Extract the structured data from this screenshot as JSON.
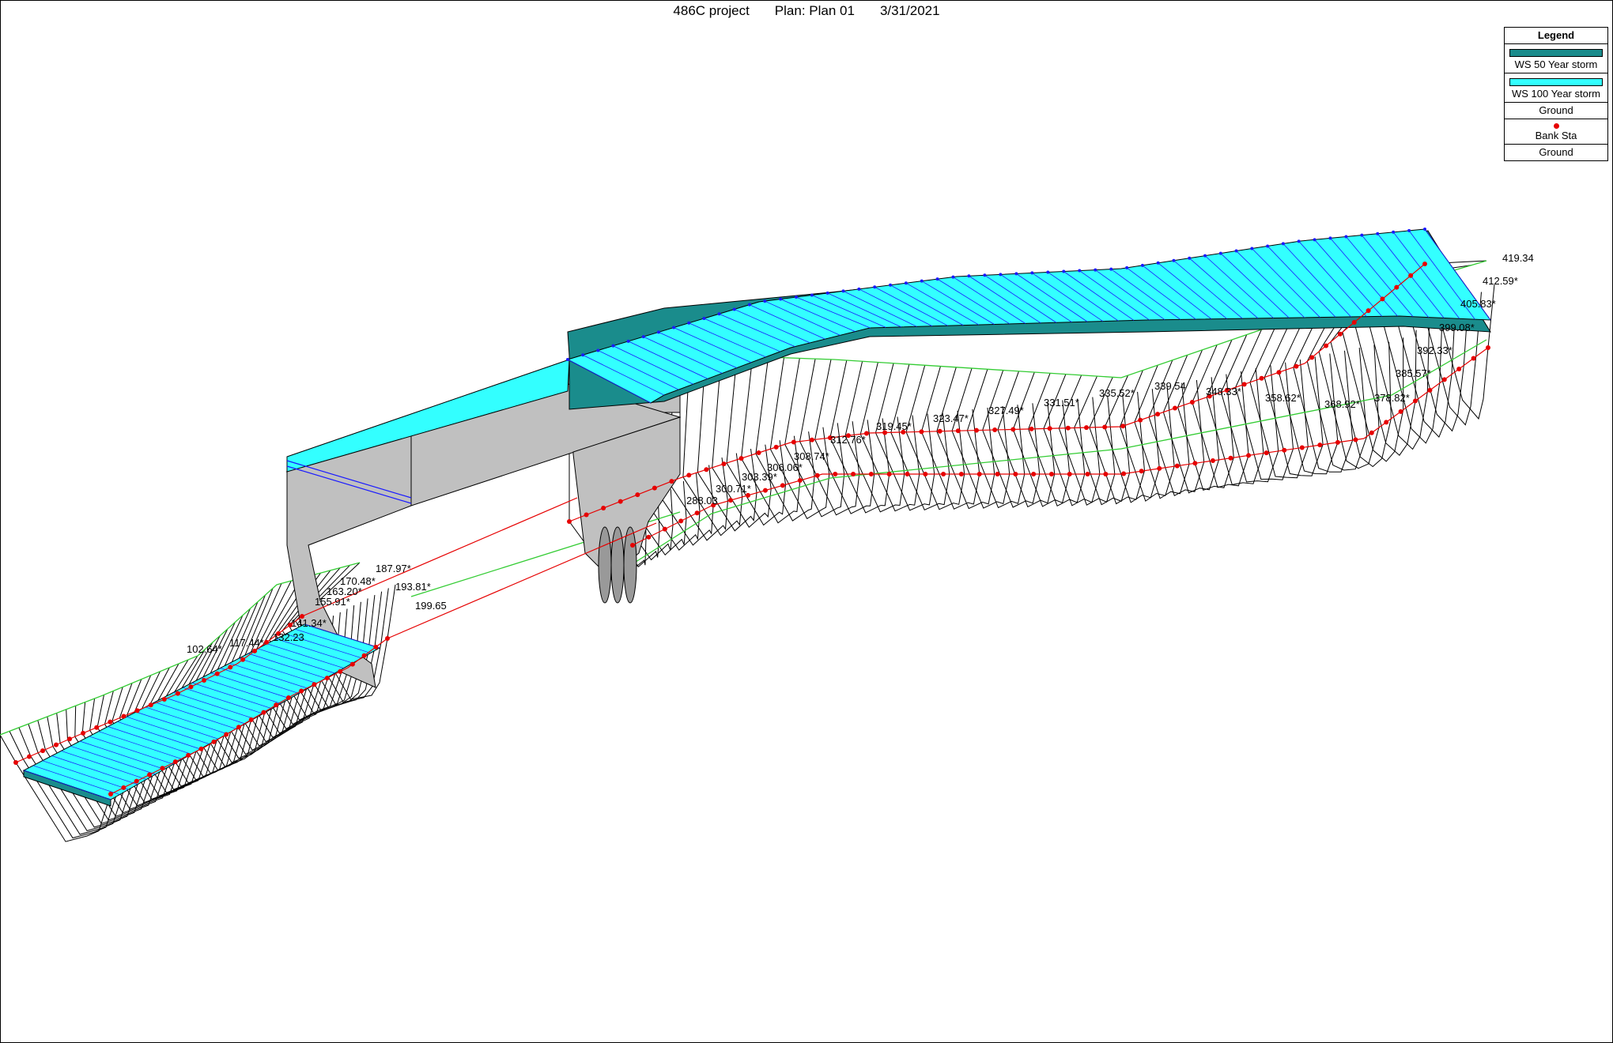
{
  "header": {
    "project": "486C project",
    "plan": "Plan: Plan 01",
    "date": "3/31/2021"
  },
  "legend": {
    "title": "Legend",
    "items": [
      {
        "label": "WS 50 Year storm",
        "color": "#1a8c8c"
      },
      {
        "label": "WS 100 Year storm",
        "color": "#33ffff"
      },
      {
        "label": "Ground",
        "color": "#33cc33"
      },
      {
        "label": "Bank Sta",
        "color": "#e60000"
      },
      {
        "label": "Ground",
        "color": "#000000"
      }
    ]
  },
  "colors": {
    "ws50": "#1a8c8c",
    "ws100": "#33ffff",
    "ground_outline": "#33cc33",
    "bank_sta": "#e60000",
    "ground": "#000000",
    "structure": "#c0c0c0",
    "ws_lines": "#1a1aff"
  },
  "cross_sections": [
    "102.64*",
    "117.44*",
    "132.23",
    "141.34*",
    "155.91*",
    "163.20*",
    "170.48*",
    "187.97*",
    "193.81*",
    "199.65",
    "288.03",
    "300.71*",
    "303.39*",
    "306.06*",
    "308.74*",
    "312.76*",
    "319.45*",
    "323.47*",
    "327.49*",
    "331.51*",
    "335.52*",
    "339.54",
    "348.33*",
    "358.62*",
    "368.92*",
    "378.82*",
    "385.57*",
    "392.33*",
    "399.08*",
    "405.83*",
    "412.59*",
    "419.34"
  ]
}
